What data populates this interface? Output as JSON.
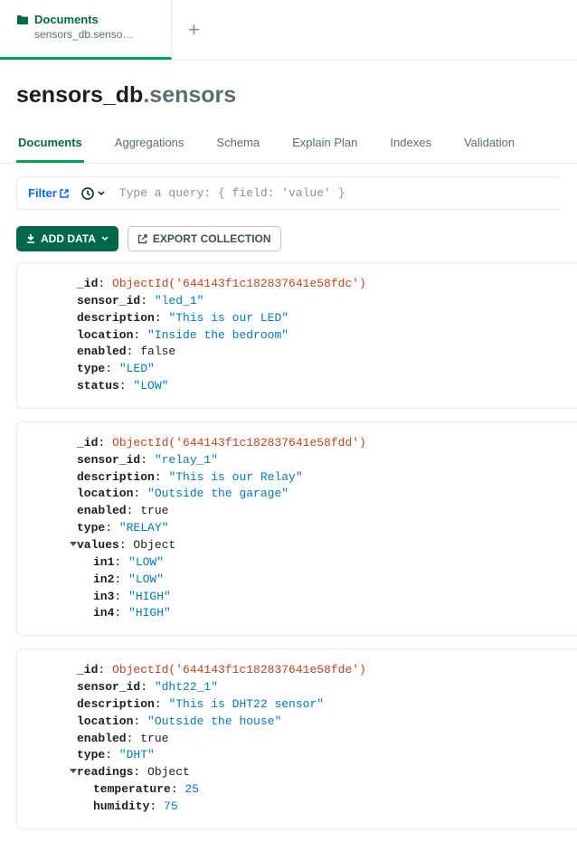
{
  "tab": {
    "title": "Documents",
    "subtitle": "sensors_db.senso…"
  },
  "title": {
    "db": "sensors_db",
    "coll": ".sensors"
  },
  "subtabs": [
    "Documents",
    "Aggregations",
    "Schema",
    "Explain Plan",
    "Indexes",
    "Validation"
  ],
  "filter": {
    "label": "Filter",
    "placeholder": "Type a query: { field: 'value' }"
  },
  "actions": {
    "add_data": "ADD DATA",
    "export": "EXPORT COLLECTION"
  },
  "docs": [
    {
      "fields": [
        {
          "indent": 1,
          "key": "_id",
          "val": "ObjectId('644143f1c182837641e58fdc')",
          "cls": "oid"
        },
        {
          "indent": 1,
          "key": "sensor_id",
          "val": "\"led_1\"",
          "cls": "str"
        },
        {
          "indent": 1,
          "key": "description",
          "val": "\"This is our LED\"",
          "cls": "str"
        },
        {
          "indent": 1,
          "key": "location",
          "val": "\"Inside the bedroom\"",
          "cls": "str"
        },
        {
          "indent": 1,
          "key": "enabled",
          "val": "false",
          "cls": "lit"
        },
        {
          "indent": 1,
          "key": "type",
          "val": "\"LED\"",
          "cls": "str"
        },
        {
          "indent": 1,
          "key": "status",
          "val": "\"LOW\"",
          "cls": "str"
        }
      ]
    },
    {
      "fields": [
        {
          "indent": 1,
          "key": "_id",
          "val": "ObjectId('644143f1c182837641e58fdd')",
          "cls": "oid"
        },
        {
          "indent": 1,
          "key": "sensor_id",
          "val": "\"relay_1\"",
          "cls": "str"
        },
        {
          "indent": 1,
          "key": "description",
          "val": "\"This is our Relay\"",
          "cls": "str"
        },
        {
          "indent": 1,
          "key": "location",
          "val": "\"Outside the garage\"",
          "cls": "str"
        },
        {
          "indent": 1,
          "key": "enabled",
          "val": "true",
          "cls": "lit"
        },
        {
          "indent": 1,
          "key": "type",
          "val": "\"RELAY\"",
          "cls": "str"
        },
        {
          "indent": 1,
          "key": "values",
          "val": "Object",
          "cls": "lit",
          "expand": true
        },
        {
          "indent": 2,
          "key": "in1",
          "val": "\"LOW\"",
          "cls": "str"
        },
        {
          "indent": 2,
          "key": "in2",
          "val": "\"LOW\"",
          "cls": "str"
        },
        {
          "indent": 2,
          "key": "in3",
          "val": "\"HIGH\"",
          "cls": "str"
        },
        {
          "indent": 2,
          "key": "in4",
          "val": "\"HIGH\"",
          "cls": "str"
        }
      ]
    },
    {
      "fields": [
        {
          "indent": 1,
          "key": "_id",
          "val": "ObjectId('644143f1c182837641e58fde')",
          "cls": "oid"
        },
        {
          "indent": 1,
          "key": "sensor_id",
          "val": "\"dht22_1\"",
          "cls": "str"
        },
        {
          "indent": 1,
          "key": "description",
          "val": "\"This is DHT22 sensor\"",
          "cls": "str"
        },
        {
          "indent": 1,
          "key": "location",
          "val": "\"Outside the house\"",
          "cls": "str"
        },
        {
          "indent": 1,
          "key": "enabled",
          "val": "true",
          "cls": "lit"
        },
        {
          "indent": 1,
          "key": "type",
          "val": "\"DHT\"",
          "cls": "str"
        },
        {
          "indent": 1,
          "key": "readings",
          "val": "Object",
          "cls": "lit",
          "expand": true
        },
        {
          "indent": 2,
          "key": "temperature",
          "val": "25",
          "cls": "num"
        },
        {
          "indent": 2,
          "key": "humidity",
          "val": "75",
          "cls": "num"
        }
      ]
    }
  ]
}
